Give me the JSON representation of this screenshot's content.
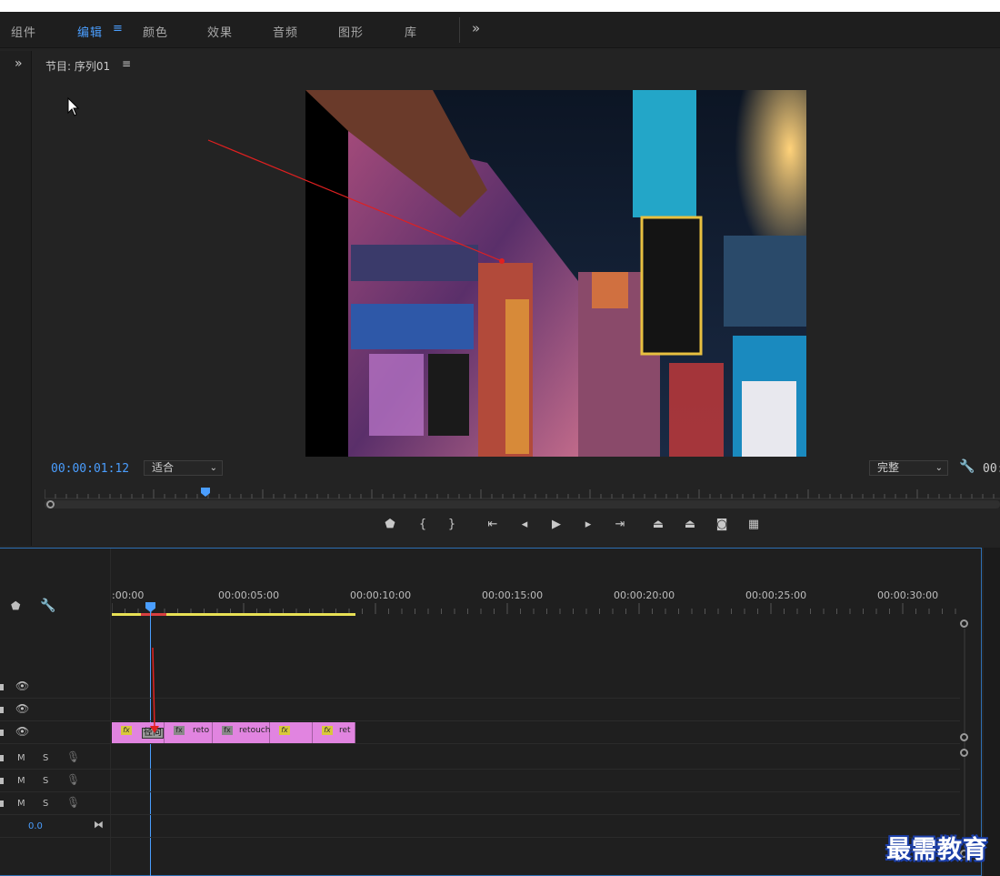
{
  "workspace": {
    "tabs": [
      {
        "label": "组件",
        "active": false
      },
      {
        "label": "编辑",
        "active": true
      },
      {
        "label": "颜色",
        "active": false
      },
      {
        "label": "效果",
        "active": false
      },
      {
        "label": "音频",
        "active": false
      },
      {
        "label": "图形",
        "active": false
      },
      {
        "label": "库",
        "active": false
      }
    ],
    "menu_icon": "≡",
    "more_icon": "»"
  },
  "left_panel": {
    "expand_icon": "»",
    "add_icon": "+"
  },
  "program_monitor": {
    "title": "节目: 序列01",
    "title_menu_icon": "≡",
    "timecode": "00:00:01:12",
    "zoom": "适合",
    "quality": "完整",
    "timecode_right": "00:",
    "transport": [
      "add-marker",
      "mark-in",
      "mark-out",
      "go-to-in",
      "step-back",
      "play",
      "step-forward",
      "go-to-out",
      "lift",
      "extract",
      "export-frame",
      "compare-view"
    ]
  },
  "timeline": {
    "ruler_labels": [
      ":00:00",
      "00:00:05:00",
      "00:00:10:00",
      "00:00:15:00",
      "00:00:20:00",
      "00:00:25:00",
      "00:00:30:00"
    ],
    "video_tracks": 3,
    "audio_tracks": 3,
    "audio_ctrl": {
      "mute": "M",
      "solo": "S"
    },
    "master_volume": "0.0",
    "clips": [
      {
        "label": "",
        "fx": "fx",
        "fx_style": "yellow",
        "tooltip": "径向"
      },
      {
        "label": "reto",
        "fx": "fx",
        "fx_style": "gray"
      },
      {
        "label": "retouch",
        "fx": "fx",
        "fx_style": "gray"
      },
      {
        "label": "",
        "fx": "fx",
        "fx_style": "yellow"
      },
      {
        "label": "ret",
        "fx": "fx",
        "fx_style": "yellow"
      }
    ]
  },
  "watermark": "最需教育",
  "colors": {
    "accent": "#4a9eff",
    "clip": "#e184e0",
    "workarea": "#e8e055",
    "annotation_arrow": "#e02020"
  }
}
